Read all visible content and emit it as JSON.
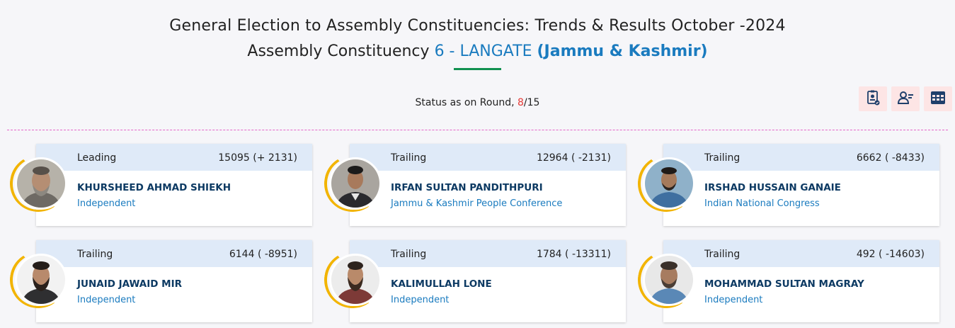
{
  "header": {
    "title_line1": "General Election to Assembly Constituencies: Trends & Results October -2024",
    "title_prefix": "Assembly Constituency",
    "constituency": "6 - LANGATE",
    "state": "(Jammu & Kashmir)"
  },
  "status": {
    "label": "Status as on Round,",
    "current_round": "8",
    "separator": "/",
    "total_rounds": "15"
  },
  "toolbar": {
    "icons": [
      "compare-icon",
      "candidate-list-icon",
      "table-view-icon"
    ]
  },
  "colors": {
    "accent_blue": "#1a7bbf",
    "name_navy": "#0d3a63",
    "underline_green": "#129150",
    "ring_gold": "#f2b400",
    "round_red": "#e53935",
    "divider_pink": "#e466c9"
  },
  "candidates": [
    {
      "status": "Leading",
      "votes": "15095 (+ 2131)",
      "name": "KHURSHEED AHMAD SHIEKH",
      "party": "Independent"
    },
    {
      "status": "Trailing",
      "votes": "12964 ( -2131)",
      "name": "IRFAN SULTAN PANDITHPURI",
      "party": "Jammu & Kashmir People Conference"
    },
    {
      "status": "Trailing",
      "votes": "6662 ( -8433)",
      "name": "IRSHAD HUSSAIN GANAIE",
      "party": "Indian National Congress"
    },
    {
      "status": "Trailing",
      "votes": "6144 ( -8951)",
      "name": "JUNAID JAWAID MIR",
      "party": "Independent"
    },
    {
      "status": "Trailing",
      "votes": "1784 ( -13311)",
      "name": "KALIMULLAH LONE",
      "party": "Independent"
    },
    {
      "status": "Trailing",
      "votes": "492 ( -14603)",
      "name": "MOHAMMAD SULTAN MAGRAY",
      "party": "Independent"
    }
  ]
}
